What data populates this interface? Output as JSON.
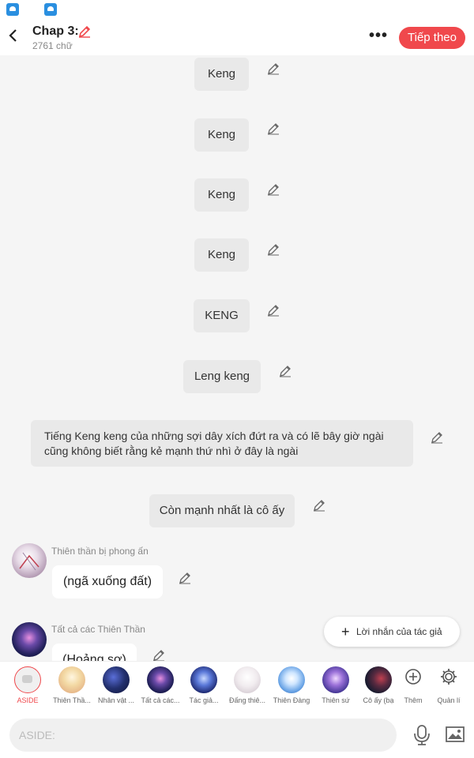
{
  "header": {
    "title": "Chap 3:",
    "word_count": "2761 chữ",
    "more": "•••",
    "next_label": "Tiếp theo"
  },
  "lines": [
    {
      "type": "aside",
      "text": "Keng"
    },
    {
      "type": "aside",
      "text": "Keng"
    },
    {
      "type": "aside",
      "text": "Keng"
    },
    {
      "type": "aside",
      "text": "Keng"
    },
    {
      "type": "aside",
      "text": "KENG"
    },
    {
      "type": "aside",
      "text": "Leng keng"
    },
    {
      "type": "aside",
      "text": "Tiếng Keng keng của những sợi dây xích đứt ra và có lẽ bây giờ ngài cũng không biết rằng kẻ mạnh thứ nhì ở đây là ngài"
    },
    {
      "type": "aside",
      "text": "Còn mạnh nhất là cô ấy"
    },
    {
      "type": "dialogue",
      "speaker": "Thiên thần bị phong ấn",
      "text": "(ngã xuống đất)"
    },
    {
      "type": "dialogue",
      "speaker": "Tất cả các Thiên Thần",
      "text": "(Hoảng sợ)"
    }
  ],
  "author_note_label": "Lời nhắn của tác giả",
  "cast": [
    {
      "name": "ASIDE",
      "icon": "aside-icon"
    },
    {
      "name": "Thiên Thầ...",
      "icon": "avatar-angel"
    },
    {
      "name": "Nhân vật ...",
      "icon": "avatar-starry"
    },
    {
      "name": "Tất cả các...",
      "icon": "avatar-galaxy"
    },
    {
      "name": "Tác giả...",
      "icon": "avatar-nebula"
    },
    {
      "name": "Đấng thiê...",
      "icon": "avatar-white"
    },
    {
      "name": "Thiên Đàng",
      "icon": "avatar-sky"
    },
    {
      "name": "Thiên sứ",
      "icon": "avatar-purple"
    },
    {
      "name": "Cô ấy (bạ",
      "icon": "avatar-dark"
    }
  ],
  "add_label": "Thêm",
  "manage_label": "Quản lí",
  "input_placeholder": "ASIDE:",
  "colors": {
    "accent": "#f0484c",
    "bubble": "#e9e9e9",
    "background": "#f5f5f5"
  }
}
